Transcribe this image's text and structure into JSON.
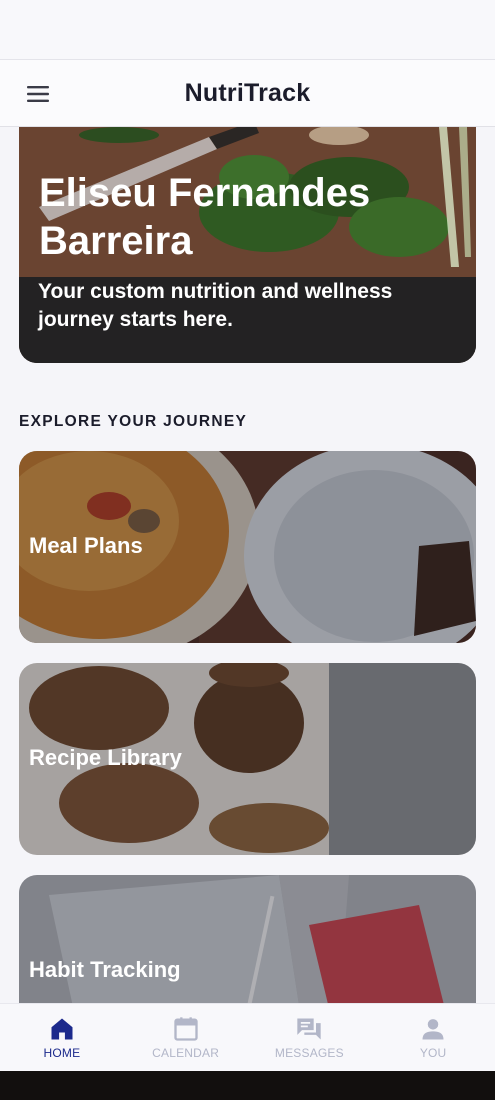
{
  "header": {
    "title": "NutriTrack",
    "menu_icon": "hamburger-menu-icon"
  },
  "hero": {
    "name": "Eliseu Fernandes Barreira",
    "tagline": "Your custom nutrition and wellness journey starts here."
  },
  "explore": {
    "heading": "EXPLORE YOUR JOURNEY",
    "cards": [
      {
        "label": "Meal Plans"
      },
      {
        "label": "Recipe Library"
      },
      {
        "label": "Habit Tracking"
      }
    ]
  },
  "tabs": [
    {
      "label": "HOME",
      "icon": "home-icon",
      "active": true
    },
    {
      "label": "CALENDAR",
      "icon": "calendar-icon",
      "active": false
    },
    {
      "label": "MESSAGES",
      "icon": "messages-icon",
      "active": false
    },
    {
      "label": "YOU",
      "icon": "person-icon",
      "active": false
    }
  ],
  "colors": {
    "active_tab": "#1c2a8c",
    "inactive_tab": "#b2b6c8",
    "title_text": "#1b1c2b"
  }
}
